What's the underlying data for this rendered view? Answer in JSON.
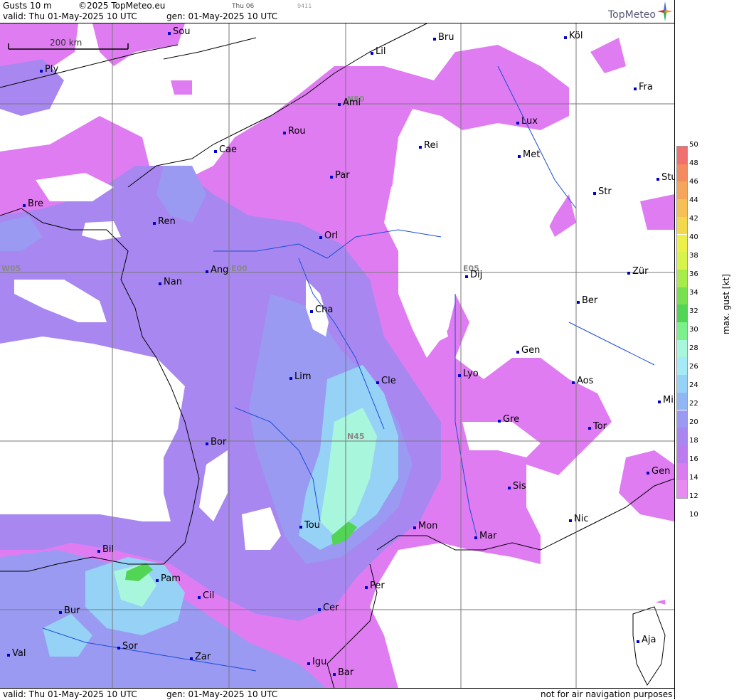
{
  "header": {
    "product": "Gusts 10 m",
    "copyright": "©2025 TopMeteo.eu",
    "day_label": "Thu 06",
    "code": "9411",
    "valid": "valid:  Thu  01-May-2025  10 UTC",
    "generated": "gen: 01-May-2025 10 UTC",
    "logo_text": "TopMeteo"
  },
  "footer": {
    "valid": "valid:  Thu  01-May-2025  10 UTC",
    "generated": "gen: 01-May-2025 10 UTC",
    "disclaimer": "not for air navigation purposes"
  },
  "scale_bar": "200 km",
  "grid_labels": {
    "n50": "N50",
    "n45": "N45",
    "w05": "W05",
    "e00": "E00",
    "e05": "E05"
  },
  "cities": [
    {
      "name": "Sou"
    },
    {
      "name": "Ply"
    },
    {
      "name": "Lil"
    },
    {
      "name": "Bru"
    },
    {
      "name": "Köl"
    },
    {
      "name": "Ami"
    },
    {
      "name": "Fra"
    },
    {
      "name": "Rou"
    },
    {
      "name": "Lux"
    },
    {
      "name": "Cae"
    },
    {
      "name": "Rei"
    },
    {
      "name": "Met"
    },
    {
      "name": "Par"
    },
    {
      "name": "Bre"
    },
    {
      "name": "Str"
    },
    {
      "name": "Stu"
    },
    {
      "name": "Ren"
    },
    {
      "name": "Orl"
    },
    {
      "name": "Ang"
    },
    {
      "name": "Dij"
    },
    {
      "name": "Zür"
    },
    {
      "name": "Nan"
    },
    {
      "name": "Cha"
    },
    {
      "name": "Ber"
    },
    {
      "name": "Gen"
    },
    {
      "name": "Lim"
    },
    {
      "name": "Cle"
    },
    {
      "name": "Lyo"
    },
    {
      "name": "Aos"
    },
    {
      "name": "Mil"
    },
    {
      "name": "Gre"
    },
    {
      "name": "Tor"
    },
    {
      "name": "Bor"
    },
    {
      "name": "Gen"
    },
    {
      "name": "Sis"
    },
    {
      "name": "Tou"
    },
    {
      "name": "Mon"
    },
    {
      "name": "Nic"
    },
    {
      "name": "Mar"
    },
    {
      "name": "Bil"
    },
    {
      "name": "Pam"
    },
    {
      "name": "Per"
    },
    {
      "name": "Cil"
    },
    {
      "name": "Cer"
    },
    {
      "name": "Bur"
    },
    {
      "name": "Sor"
    },
    {
      "name": "Aja"
    },
    {
      "name": "Val"
    },
    {
      "name": "Zar"
    },
    {
      "name": "Igu"
    },
    {
      "name": "Bar"
    }
  ],
  "legend": {
    "title": "max. gust  [kt]",
    "ticks": [
      "50",
      "48",
      "46",
      "44",
      "42",
      "40",
      "38",
      "36",
      "34",
      "32",
      "30",
      "28",
      "26",
      "24",
      "22",
      "20",
      "18",
      "16",
      "14",
      "12",
      "10"
    ],
    "colors": [
      "#f07070",
      "#f48a60",
      "#f6a65a",
      "#f6c054",
      "#f4d84c",
      "#eef04a",
      "#d8f34a",
      "#a8ec4c",
      "#78e04e",
      "#52d454",
      "#7cf08a",
      "#a8f6dc",
      "#a6eaf8",
      "#96d2f6",
      "#90b6f4",
      "#9a9af2",
      "#a888f0",
      "#bc7cf0",
      "#d87cf0",
      "#e88af2"
    ]
  }
}
